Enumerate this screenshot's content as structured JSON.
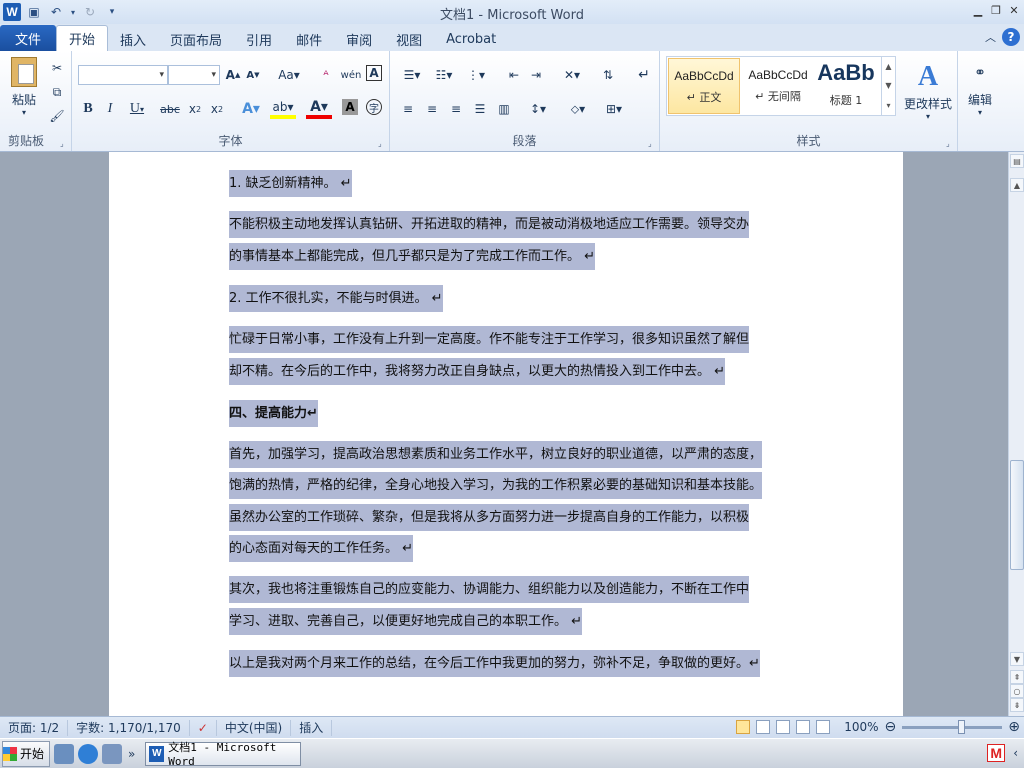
{
  "window": {
    "title": "文档1  -  Microsoft Word",
    "logo_letter": "W"
  },
  "tabs": {
    "file": "文件",
    "items": [
      "开始",
      "插入",
      "页面布局",
      "引用",
      "邮件",
      "审阅",
      "视图",
      "Acrobat"
    ],
    "active_index": 0
  },
  "ribbon": {
    "clipboard": {
      "label": "剪贴板",
      "paste": "粘贴"
    },
    "font": {
      "label": "字体",
      "font_name": "",
      "font_size": ""
    },
    "paragraph": {
      "label": "段落"
    },
    "styles": {
      "label": "样式",
      "items": [
        {
          "sample": "AaBbCcDd",
          "name": "↵ 正文"
        },
        {
          "sample": "AaBbCcDd",
          "name": "↵ 无间隔"
        },
        {
          "sample": "AaBb",
          "name": "标题 1"
        }
      ],
      "change_styles": "更改样式"
    },
    "editing": {
      "label": "编辑"
    }
  },
  "document": {
    "paragraphs": [
      {
        "lines": [
          "1.  缺乏创新精神。 ↵"
        ],
        "type": "body"
      },
      {
        "lines": [
          "不能积极主动地发挥认真钻研、开拓进取的精神，而是被动消极地适应工作需要。领导交办",
          "的事情基本上都能完成，但几乎都只是为了完成工作而工作。 ↵"
        ],
        "type": "body"
      },
      {
        "lines": [
          "2.  工作不很扎实，不能与时俱进。 ↵"
        ],
        "type": "body"
      },
      {
        "lines": [
          "忙碌于日常小事，工作没有上升到一定高度。作不能专注于工作学习，很多知识虽然了解但",
          "却不精。在今后的工作中，我将努力改正自身缺点，以更大的热情投入到工作中去。 ↵"
        ],
        "type": "body"
      },
      {
        "lines": [
          "四、提高能力↵"
        ],
        "type": "heading"
      },
      {
        "lines": [
          "首先，加强学习，提高政治思想素质和业务工作水平，树立良好的职业道德，以严肃的态度，",
          "饱满的热情，严格的纪律，全身心地投入学习，为我的工作积累必要的基础知识和基本技能。",
          "虽然办公室的工作琐碎、繁杂，但是我将从多方面努力进一步提高自身的工作能力，以积极",
          "的心态面对每天的工作任务。 ↵"
        ],
        "type": "body"
      },
      {
        "lines": [
          "其次，我也将注重锻炼自己的应变能力、协调能力、组织能力以及创造能力，不断在工作中",
          "学习、进取、完善自己，以便更好地完成自己的本职工作。 ↵"
        ],
        "type": "body"
      },
      {
        "lines": [
          "以上是我对两个月来工作的总结，在今后工作中我更加的努力，弥补不足，争取做的更好。↵"
        ],
        "type": "body"
      }
    ]
  },
  "statusbar": {
    "page": "页面: 1/2",
    "words": "字数: 1,170/1,170",
    "language": "中文(中国)",
    "mode": "插入",
    "zoom": "100%"
  },
  "taskbar": {
    "start": "开始",
    "task_title": "文档1 - Microsoft Word"
  }
}
